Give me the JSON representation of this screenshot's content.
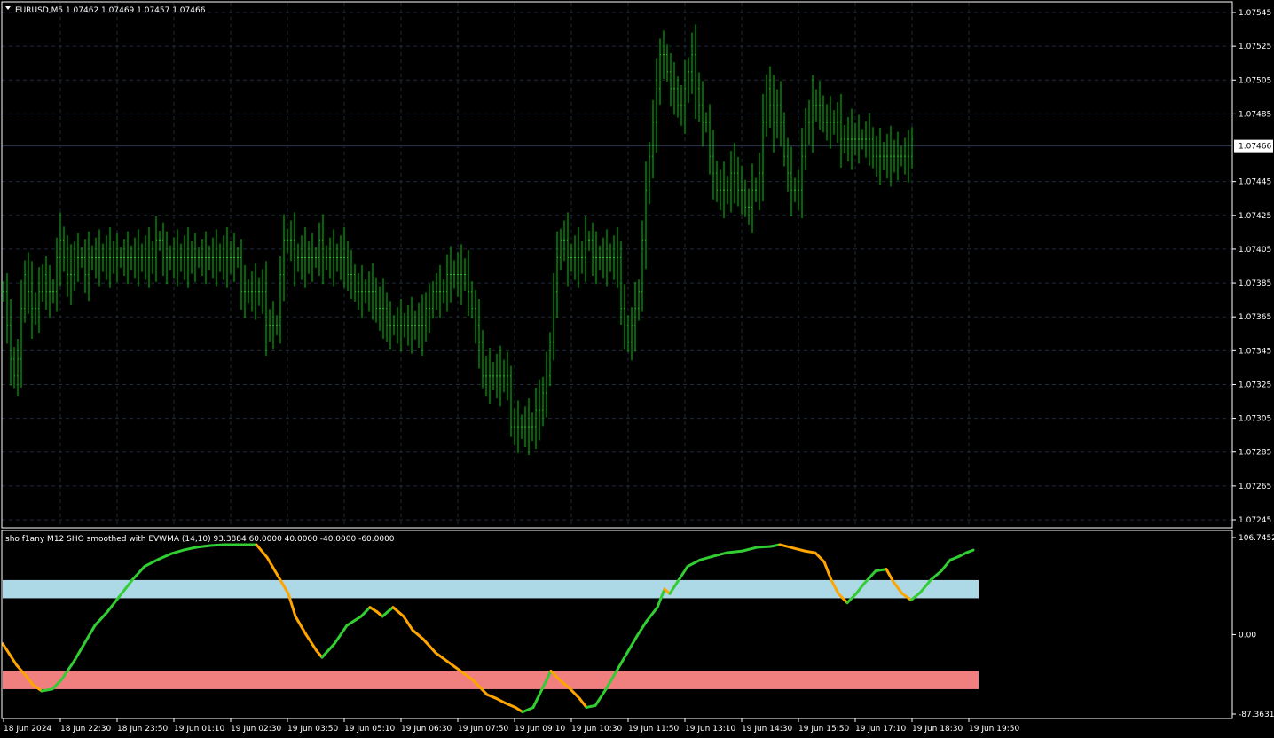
{
  "main_chart": {
    "title": "EURUSD,M5  1.07462 1.07469 1.07457 1.07466",
    "price_labels": [
      "1.07545",
      "1.07525",
      "1.07505",
      "1.07485",
      "1.07445",
      "1.07425",
      "1.07405",
      "1.07385",
      "1.07365",
      "1.07345",
      "1.07325",
      "1.07305",
      "1.07285",
      "1.07265",
      "1.07245"
    ],
    "current_price": "1.07466",
    "bar_color": "#00c800",
    "grid_color": "#1f2a3a"
  },
  "indicator": {
    "title": "sho f1any  M12 SHO smoothed with EVWMA (14,10) 93.3884 60.0000 40.0000 -40.0000 -60.0000",
    "axis_labels": [
      "106.7452",
      "0.00",
      "-87.3631"
    ],
    "upper_band_color": "#add8e6",
    "lower_band_color": "#f08080",
    "up_color": "#32cd32",
    "down_color": "#ffa500"
  },
  "time_labels": [
    "18 Jun 2024",
    "18 Jun 22:30",
    "18 Jun 23:50",
    "19 Jun 01:10",
    "19 Jun 02:30",
    "19 Jun 03:50",
    "19 Jun 05:10",
    "19 Jun 06:30",
    "19 Jun 07:50",
    "19 Jun 09:10",
    "19 Jun 10:30",
    "19 Jun 11:50",
    "19 Jun 13:10",
    "19 Jun 14:30",
    "19 Jun 15:50",
    "19 Jun 17:10",
    "19 Jun 18:30",
    "19 Jun 19:50"
  ],
  "chart_data": [
    {
      "type": "line",
      "title": "EURUSD,M5  1.07462 1.07469 1.07457 1.07466",
      "ylim": [
        1.07245,
        1.07545
      ],
      "x": [
        0,
        2,
        4,
        6,
        8,
        10,
        12,
        14,
        16,
        18,
        20,
        22,
        24,
        26,
        28,
        30,
        32,
        34,
        36,
        38,
        40,
        42,
        44,
        46,
        48,
        50,
        52,
        54,
        56,
        58,
        60,
        62,
        64,
        66,
        68,
        70,
        72,
        74,
        76,
        78,
        80,
        82,
        84,
        86,
        88,
        90,
        92,
        94,
        96,
        98,
        100,
        102,
        104,
        106,
        108,
        110,
        112,
        114,
        116,
        118,
        120,
        122,
        124,
        126,
        128,
        130,
        132,
        134,
        136,
        138,
        140,
        142,
        144,
        146,
        148,
        150,
        152,
        154,
        156,
        158,
        160,
        162,
        164,
        166,
        168,
        170,
        172,
        174,
        176,
        178,
        180,
        182,
        184,
        186,
        188,
        190,
        192,
        194,
        196,
        198,
        200,
        202,
        204,
        206,
        208,
        210,
        212,
        214,
        216,
        218,
        220,
        222,
        224,
        226,
        228,
        230,
        232,
        234,
        236,
        238,
        240,
        242,
        244,
        246,
        248,
        250,
        252,
        254,
        256,
        258,
        260,
        262,
        264,
        266,
        268,
        270,
        272,
        274,
        276,
        278,
        280,
        282,
        284,
        286,
        288,
        290,
        292,
        294,
        296,
        298,
        300,
        302,
        304,
        306,
        308,
        310,
        312,
        314,
        316,
        318,
        320,
        322,
        324,
        326,
        328,
        330,
        332,
        334,
        336,
        338,
        340,
        342,
        344,
        346,
        348,
        350,
        352,
        354,
        356,
        358,
        360,
        362,
        364,
        366,
        368,
        370,
        372,
        374,
        376,
        378,
        380,
        382,
        384,
        386,
        388,
        390,
        392,
        394,
        396,
        398,
        400,
        402,
        404,
        406,
        408,
        410,
        412,
        414,
        416,
        418,
        420,
        422,
        424,
        426,
        428,
        430,
        432,
        434,
        436,
        438,
        440,
        442,
        444,
        446,
        448,
        450,
        452,
        454,
        456,
        458,
        460,
        462,
        464,
        466,
        468,
        470,
        472,
        474,
        476,
        478,
        480,
        482,
        484,
        486,
        488,
        490,
        492,
        494,
        496,
        498,
        500,
        502,
        504,
        506,
        508,
        510,
        512,
        514,
        516,
        518,
        520,
        522,
        524,
        526,
        528,
        530,
        532,
        534,
        536,
        538,
        540,
        542,
        544,
        546,
        548,
        550
      ],
      "series": [
        {
          "values": [
            1.0738,
            1.0736,
            1.0734,
            1.0733,
            1.0734,
            1.0737,
            1.0739,
            1.0738,
            1.0737,
            1.0737,
            1.0738,
            1.0739,
            1.0738,
            1.0738,
            1.0738,
            1.074,
            1.0741,
            1.074,
            1.0739,
            1.0739,
            1.074,
            1.074,
            1.074,
            1.0739,
            1.074,
            1.074,
            1.074,
            1.074,
            1.074,
            1.074,
            1.074,
            1.074,
            1.074,
            1.074,
            1.074,
            1.074,
            1.074,
            1.074,
            1.074,
            1.074,
            1.074,
            1.074,
            1.074,
            1.0741,
            1.0741,
            1.074,
            1.074,
            1.074,
            1.074,
            1.074,
            1.074,
            1.074,
            1.074,
            1.074,
            1.074,
            1.074,
            1.074,
            1.074,
            1.074,
            1.074,
            1.074,
            1.074,
            1.074,
            1.074,
            1.074,
            1.074,
            1.074,
            1.0738,
            1.0738,
            1.0738,
            1.0738,
            1.0738,
            1.0738,
            1.0738,
            1.0736,
            1.0736,
            1.0736,
            1.0736,
            1.0739,
            1.0741,
            1.0741,
            1.0741,
            1.074,
            1.074,
            1.074,
            1.074,
            1.074,
            1.074,
            1.074,
            1.0741,
            1.074,
            1.074,
            1.074,
            1.074,
            1.074,
            1.074,
            1.074,
            1.0739,
            1.0739,
            1.0738,
            1.0738,
            1.0738,
            1.0738,
            1.0738,
            1.0738,
            1.0737,
            1.0737,
            1.0737,
            1.0736,
            1.0736,
            1.0736,
            1.0736,
            1.0736,
            1.0736,
            1.0736,
            1.0736,
            1.0736,
            1.0736,
            1.0736,
            1.0737,
            1.0737,
            1.0738,
            1.0738,
            1.0738,
            1.0738,
            1.0739,
            1.0739,
            1.0739,
            1.0739,
            1.0739,
            1.0739,
            1.0738,
            1.0737,
            1.0736,
            1.0735,
            1.0733,
            1.0733,
            1.0733,
            1.0733,
            1.0733,
            1.0733,
            1.0733,
            1.0733,
            1.073,
            1.073,
            1.073,
            1.073,
            1.073,
            1.073,
            1.073,
            1.0731,
            1.0731,
            1.0732,
            1.0733,
            1.0735,
            1.0738,
            1.074,
            1.0741,
            1.0741,
            1.074,
            1.074,
            1.074,
            1.074,
            1.074,
            1.0741,
            1.0741,
            1.074,
            1.074,
            1.074,
            1.074,
            1.074,
            1.074,
            1.074,
            1.074,
            1.0737,
            1.0736,
            1.0735,
            1.0736,
            1.0737,
            1.0738,
            1.0741,
            1.0744,
            1.0746,
            1.0748,
            1.075,
            1.0752,
            1.0752,
            1.0751,
            1.075,
            1.075,
            1.0749,
            1.0749,
            1.075,
            1.0751,
            1.0752,
            1.075,
            1.0749,
            1.0748,
            1.0748,
            1.0746,
            1.0745,
            1.0744,
            1.0744,
            1.0744,
            1.0744,
            1.0745,
            1.0745,
            1.0744,
            1.0744,
            1.0743,
            1.0743,
            1.0744,
            1.0744,
            1.0745,
            1.0748,
            1.075,
            1.0749,
            1.0748,
            1.0749,
            1.0748,
            1.0746,
            1.0745,
            1.0744,
            1.0744,
            1.0744,
            1.0746,
            1.0748,
            1.0748,
            1.0749,
            1.0749,
            1.0749,
            1.0748,
            1.0748,
            1.0748,
            1.0748,
            1.0748,
            1.0747,
            1.0747,
            1.0747,
            1.0747,
            1.0747,
            1.0747,
            1.0747,
            1.0747,
            1.0747,
            1.0746,
            1.0746,
            1.0746,
            1.0746,
            1.0746,
            1.0746,
            1.0746,
            1.0746,
            1.0746,
            1.0746,
            1.0746,
            1.0747
          ]
        }
      ]
    },
    {
      "type": "line",
      "title": "sho f1any  M12 SHO smoothed with EVWMA (14,10) 93.3884 60.0000 40.0000 -40.0000 -60.0000",
      "ylim": [
        -87.3631,
        106.7452
      ],
      "x": [
        0,
        8,
        16,
        26,
        34,
        44,
        56,
        66,
        80,
        92,
        104,
        118,
        134,
        146,
        160,
        176,
        190,
        204,
        218,
        234,
        250,
        262,
        276,
        286,
        298,
        310,
        322,
        330,
        342,
        354,
        360,
        374,
        388,
        404,
        414,
        422,
        428,
        440,
        452,
        462,
        474,
        488,
        502,
        516,
        530,
        538,
        546,
        556,
        566,
        578,
        586,
        598,
        608,
        618,
        628,
        640,
        650,
        658,
        668,
        680,
        692,
        704,
        716,
        726,
        738,
        746,
        752,
        762,
        772,
        786,
        800,
        816,
        834,
        850,
        866,
        876,
        892,
        904,
        916,
        926,
        934,
        942,
        952,
        962,
        970,
        984,
        996,
        1004,
        1014,
        1024,
        1034,
        1046,
        1058,
        1068,
        1078,
        1086,
        1094,
        1102
      ],
      "values": [
        -10,
        -22,
        -34,
        -45,
        -55,
        -62,
        -60,
        -50,
        -30,
        -10,
        10,
        25,
        45,
        60,
        75,
        83,
        89,
        93,
        96,
        98,
        99,
        99,
        99,
        99,
        85,
        65,
        45,
        20,
        0,
        -18,
        -25,
        -10,
        10,
        20,
        30,
        25,
        20,
        30,
        20,
        5,
        -5,
        -20,
        -30,
        -40,
        -50,
        -58,
        -66,
        -70,
        -75,
        -80,
        -85,
        -80,
        -60,
        -40,
        -50,
        -60,
        -70,
        -80,
        -78,
        -60,
        -40,
        -20,
        0,
        15,
        30,
        50,
        45,
        60,
        75,
        82,
        86,
        90,
        92,
        96,
        97,
        99,
        95,
        92,
        90,
        80,
        60,
        45,
        35,
        45,
        55,
        70,
        72,
        58,
        45,
        38,
        46,
        60,
        70,
        82,
        86,
        90,
        93
      ]
    }
  ]
}
